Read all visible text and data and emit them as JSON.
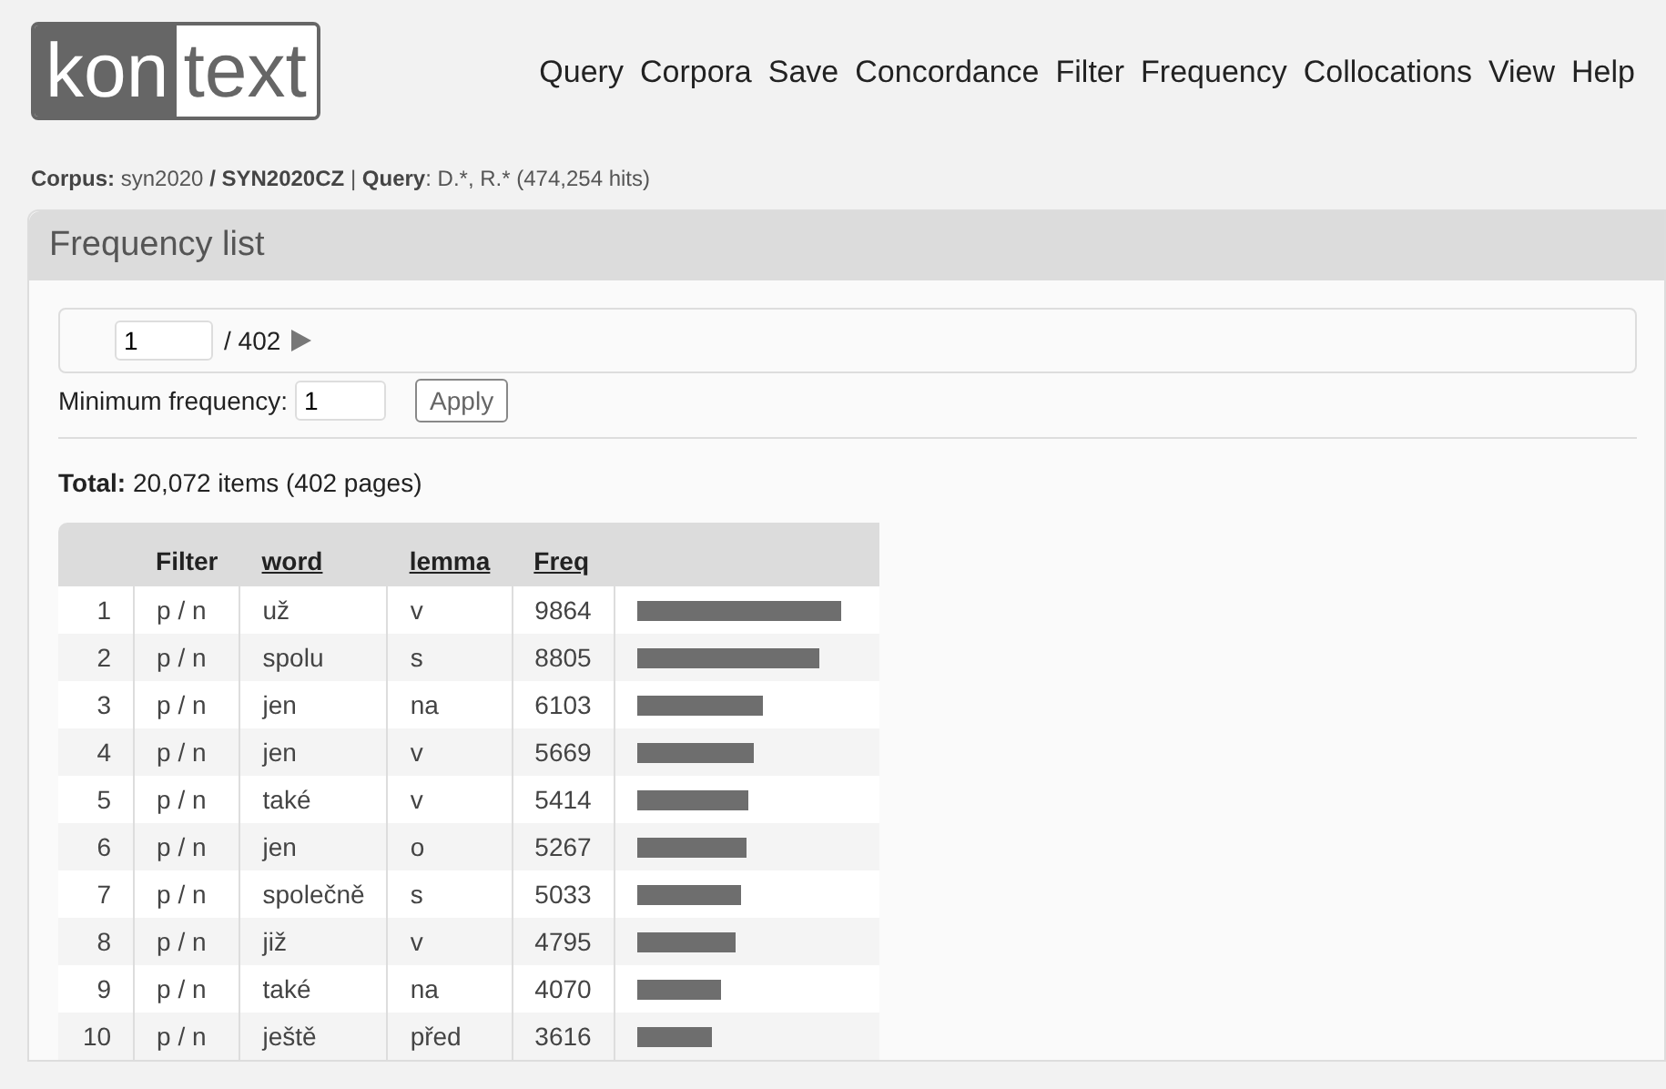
{
  "logo": {
    "dark": "kon",
    "light": "text"
  },
  "menu": [
    "Query",
    "Corpora",
    "Save",
    "Concordance",
    "Filter",
    "Frequency",
    "Collocations",
    "View",
    "Help"
  ],
  "breadcrumb": {
    "corpus_label": "Corpus:",
    "corpus": "syn2020",
    "subcorpus": "/ SYN2020CZ",
    "separator": "|",
    "query_label": "Query",
    "query": ": D.*, R.* (474,254 hits)"
  },
  "panel": {
    "title": "Frequency list",
    "pager": {
      "page": "1",
      "total": "/ 402"
    },
    "min_freq": {
      "label": "Minimum frequency:",
      "value": "1",
      "button": "Apply"
    },
    "total": "**Total:** 20,072 items (402 pages)",
    "table": {
      "columns": [
        "Filter",
        "word",
        "lemma",
        "Freq"
      ],
      "rows": [
        {
          "num": "1",
          "filter": "p / n",
          "word": "už",
          "lemma": "v",
          "freq": "9864"
        },
        {
          "num": "2",
          "filter": "p / n",
          "word": "spolu",
          "lemma": "s",
          "freq": "8805"
        },
        {
          "num": "3",
          "filter": "p / n",
          "word": "jen",
          "lemma": "na",
          "freq": "6103"
        },
        {
          "num": "4",
          "filter": "p / n",
          "word": "jen",
          "lemma": "v",
          "freq": "5669"
        },
        {
          "num": "5",
          "filter": "p / n",
          "word": "také",
          "lemma": "v",
          "freq": "5414"
        },
        {
          "num": "6",
          "filter": "p / n",
          "word": "jen",
          "lemma": "o",
          "freq": "5267"
        },
        {
          "num": "7",
          "filter": "p / n",
          "word": "společně",
          "lemma": "s",
          "freq": "5033"
        },
        {
          "num": "8",
          "filter": "p / n",
          "word": "již",
          "lemma": "v",
          "freq": "4795"
        },
        {
          "num": "9",
          "filter": "p / n",
          "word": "také",
          "lemma": "na",
          "freq": "4070"
        },
        {
          "num": "10",
          "filter": "p / n",
          "word": "ještě",
          "lemma": "před",
          "freq": "3616"
        }
      ]
    }
  }
}
